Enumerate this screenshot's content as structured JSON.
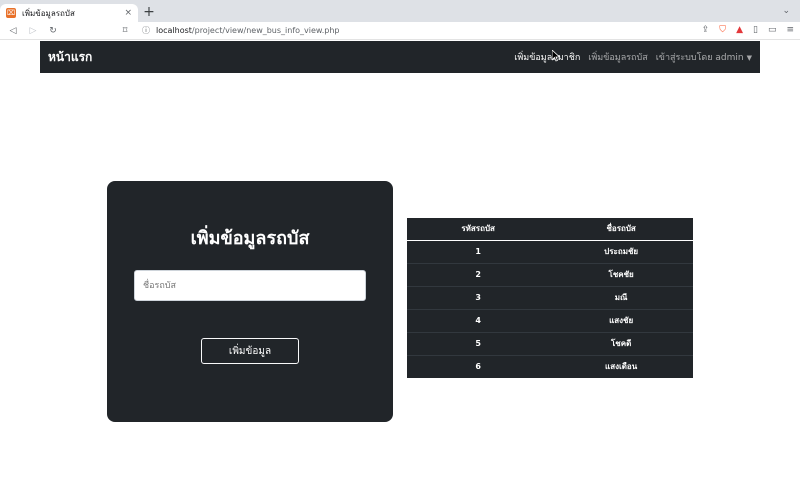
{
  "browser": {
    "tab_title": "เพิ่มข้อมูลรถบัส",
    "tab_close": "×",
    "new_tab": "+",
    "tab_search": "⌄",
    "url_host": "localhost",
    "url_path": "/project/view/new_bus_info_view.php"
  },
  "navbar": {
    "brand": "หน้าแรก",
    "links": [
      "เพิ่มข้อมูลสมาชิก",
      "เพิ่มข้อมูลรถบัส",
      "เข้าสู่ระบบโดย admin"
    ]
  },
  "form": {
    "title": "เพิ่มข้อมูลรถบัส",
    "input_placeholder": "ชื่อรถบัส",
    "submit_label": "เพิ่มข้อมูล"
  },
  "table": {
    "headers": [
      "รหัสรถบัส",
      "ชื่อรถบัส"
    ],
    "rows": [
      [
        "1",
        "ประถมชัย"
      ],
      [
        "2",
        "โชคชัย"
      ],
      [
        "3",
        "มณี"
      ],
      [
        "4",
        "แสงชัย"
      ],
      [
        "5",
        "โชคดี"
      ],
      [
        "6",
        "แสงเดือน"
      ]
    ]
  },
  "colors": {
    "navbar_bg": "#212529",
    "tabstrip_bg": "#dee1e6",
    "favicon": "#e8712a",
    "brave": "#fb542b"
  }
}
